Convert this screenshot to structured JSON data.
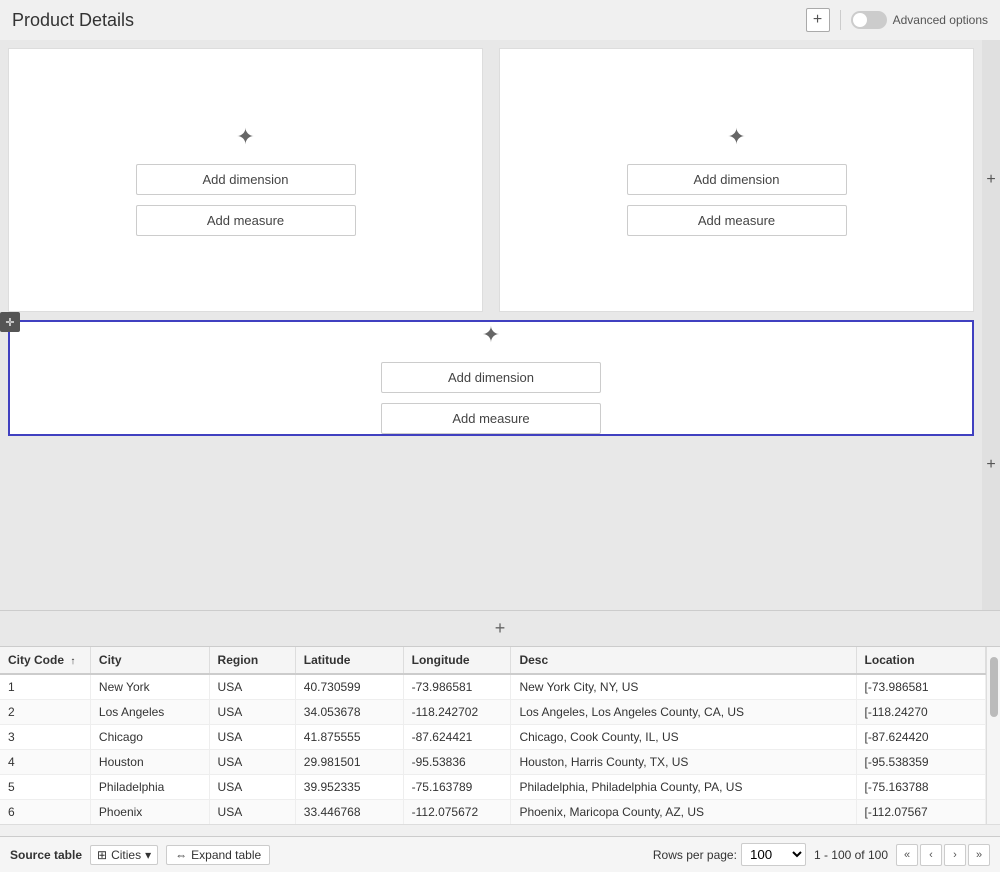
{
  "header": {
    "title": "Product Details",
    "add_label": "+",
    "advanced_options_label": "Advanced options"
  },
  "panels": {
    "top_left": {
      "icon": "✦",
      "add_dimension_label": "Add dimension",
      "add_measure_label": "Add measure"
    },
    "top_right": {
      "icon": "✦",
      "add_dimension_label": "Add dimension",
      "add_measure_label": "Add measure"
    },
    "middle": {
      "icon": "✦",
      "add_dimension_label": "Add dimension",
      "add_measure_label": "Add measure"
    },
    "plus_right_top": "+",
    "plus_right_bottom": "+"
  },
  "add_panel_bar": {
    "icon": "+"
  },
  "table": {
    "columns": [
      {
        "id": "city_code",
        "label": "City Code",
        "sortable": true,
        "sort_dir": "asc"
      },
      {
        "id": "city",
        "label": "City"
      },
      {
        "id": "region",
        "label": "Region"
      },
      {
        "id": "latitude",
        "label": "Latitude"
      },
      {
        "id": "longitude",
        "label": "Longitude"
      },
      {
        "id": "desc",
        "label": "Desc"
      },
      {
        "id": "location",
        "label": "Location"
      }
    ],
    "rows": [
      {
        "city_code": "1",
        "city": "New York",
        "region": "USA",
        "latitude": "40.730599",
        "longitude": "-73.986581",
        "desc": "New York City, NY, US",
        "location": "[-73.986581"
      },
      {
        "city_code": "2",
        "city": "Los Angeles",
        "region": "USA",
        "latitude": "34.053678",
        "longitude": "-118.242702",
        "desc": "Los Angeles, Los Angeles County, CA, US",
        "location": "[-118.24270"
      },
      {
        "city_code": "3",
        "city": "Chicago",
        "region": "USA",
        "latitude": "41.875555",
        "longitude": "-87.624421",
        "desc": "Chicago, Cook County, IL, US",
        "location": "[-87.624420"
      },
      {
        "city_code": "4",
        "city": "Houston",
        "region": "USA",
        "latitude": "29.981501",
        "longitude": "-95.53836",
        "desc": "Houston, Harris County, TX, US",
        "location": "[-95.538359"
      },
      {
        "city_code": "5",
        "city": "Philadelphia",
        "region": "USA",
        "latitude": "39.952335",
        "longitude": "-75.163789",
        "desc": "Philadelphia, Philadelphia County, PA, US",
        "location": "[-75.163788"
      },
      {
        "city_code": "6",
        "city": "Phoenix",
        "region": "USA",
        "latitude": "33.446768",
        "longitude": "-112.075672",
        "desc": "Phoenix, Maricopa County, AZ, US",
        "location": "[-112.07567"
      }
    ]
  },
  "footer": {
    "source_label": "Source table",
    "table_name": "Cities",
    "expand_label": "Expand table",
    "rows_per_page_label": "Rows per page:",
    "rows_per_page_value": "100",
    "page_info": "1 - 100 of 100",
    "nav_first": "«",
    "nav_prev": "‹",
    "nav_next": "›",
    "nav_last": "»"
  }
}
